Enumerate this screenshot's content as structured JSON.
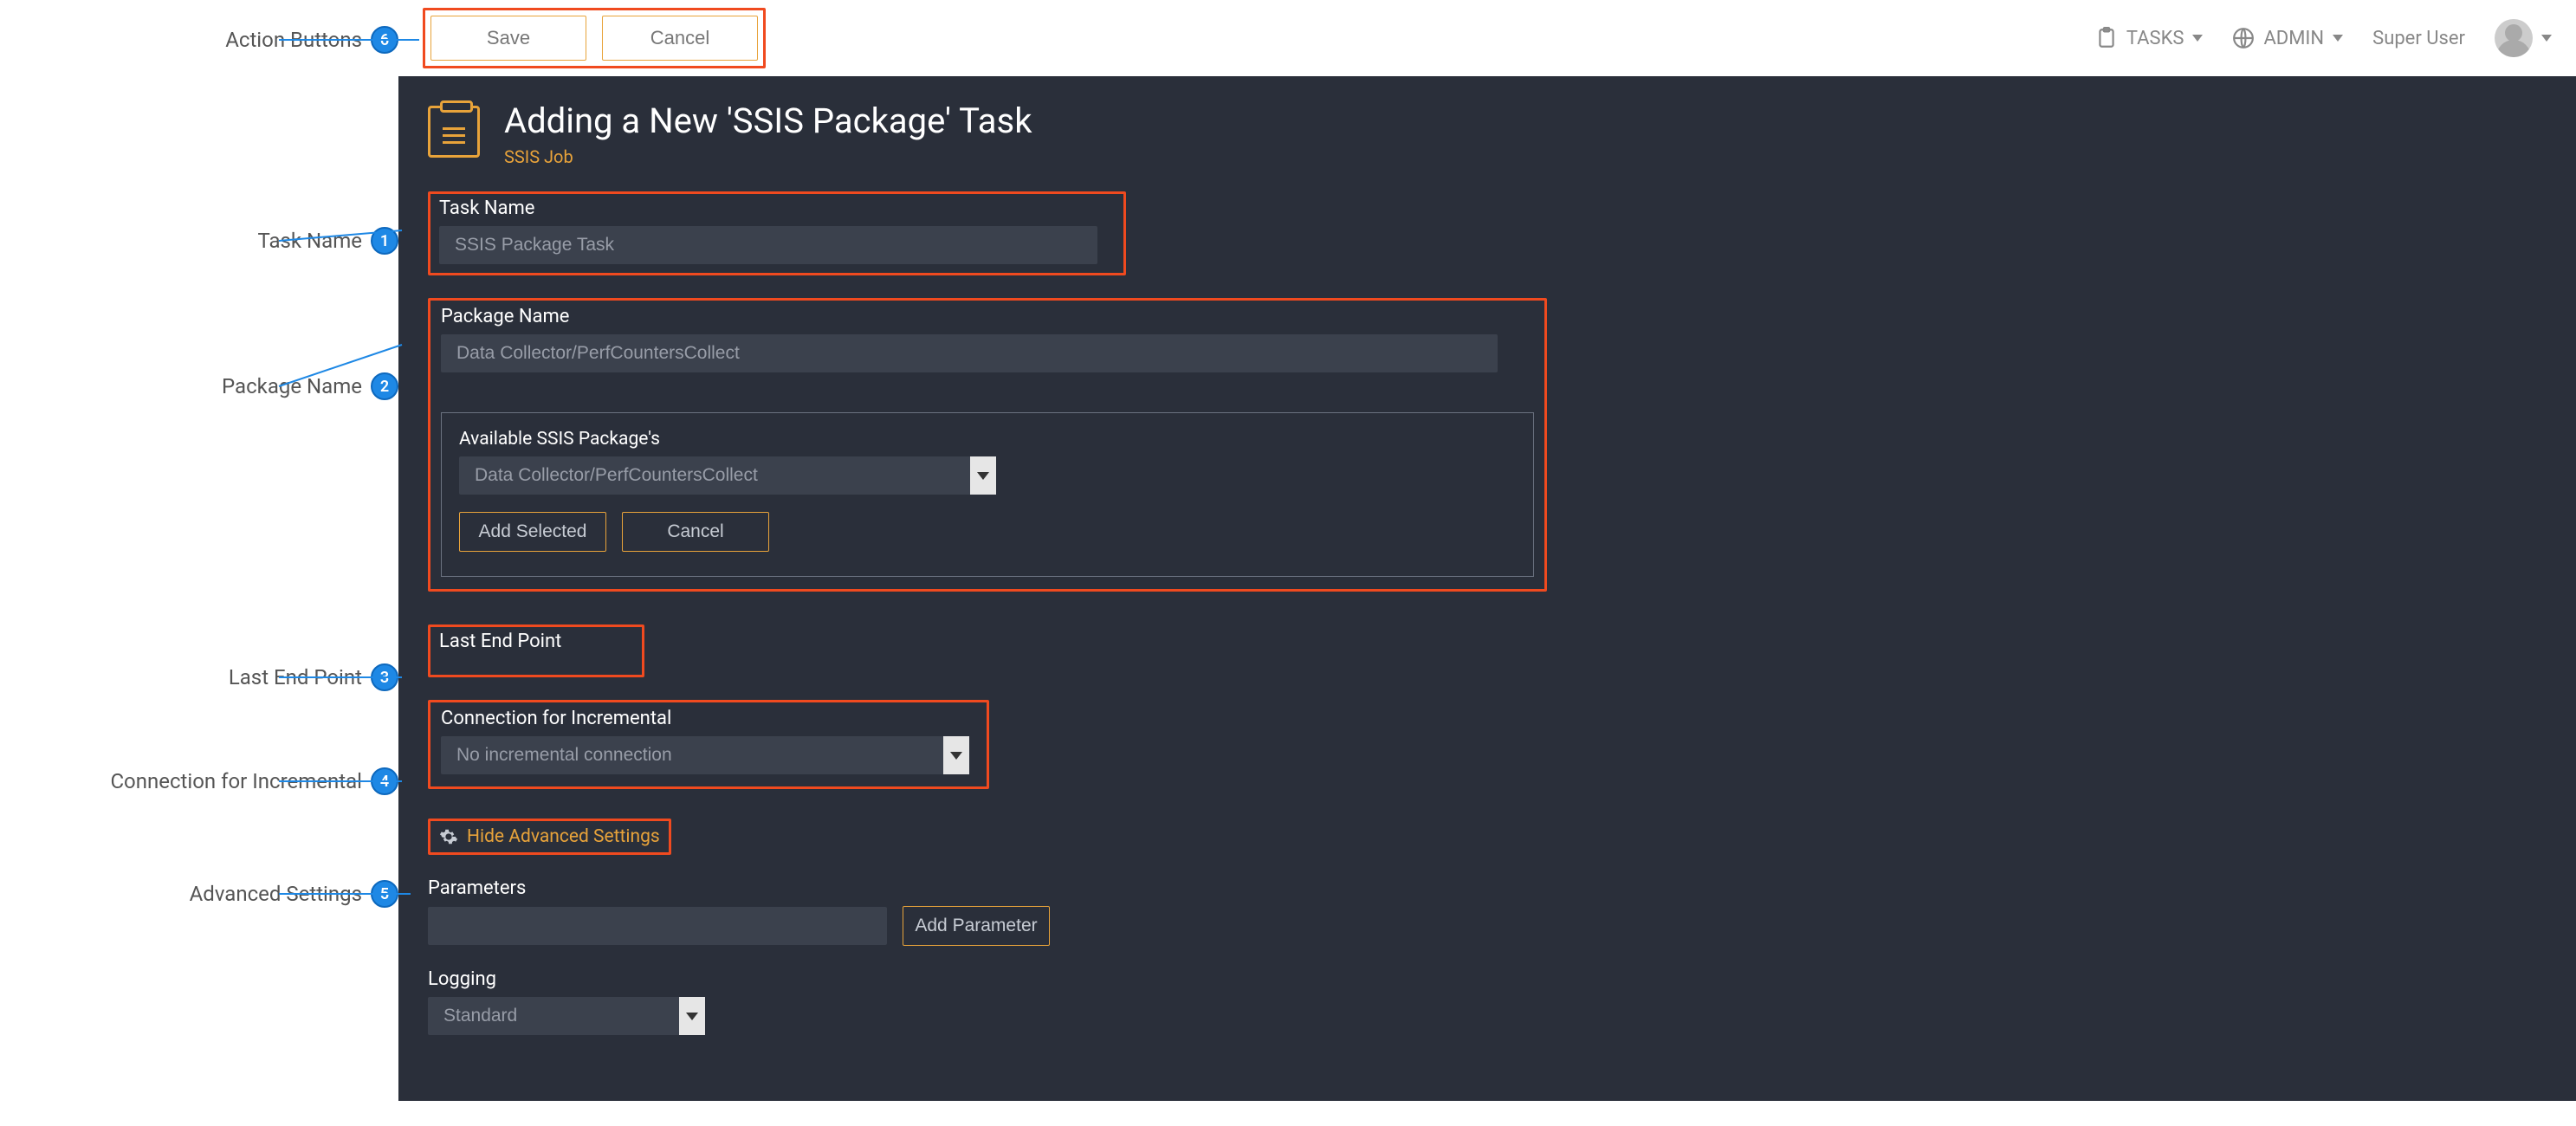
{
  "annotations": [
    {
      "n": 6,
      "label": "Action Buttons"
    },
    {
      "n": 1,
      "label": "Task Name"
    },
    {
      "n": 2,
      "label": "Package Name"
    },
    {
      "n": 3,
      "label": "Last End Point"
    },
    {
      "n": 4,
      "label": "Connection for Incremental"
    },
    {
      "n": 5,
      "label": "Advanced Settings"
    }
  ],
  "topbar": {
    "save": "Save",
    "cancel": "Cancel",
    "tasks": "TASKS",
    "admin": "ADMIN",
    "user": "Super User"
  },
  "header": {
    "title": "Adding a New 'SSIS Package' Task",
    "subtitle": "SSIS Job"
  },
  "form": {
    "taskname_label": "Task Name",
    "taskname_value": "SSIS Package Task",
    "pkgname_label": "Package Name",
    "pkgname_value": "Data Collector/PerfCountersCollect",
    "avail_label": "Available SSIS Package's",
    "avail_value": "Data Collector/PerfCountersCollect",
    "add_selected": "Add Selected",
    "cancel": "Cancel",
    "lep_label": "Last End Point",
    "conn_label": "Connection for Incremental",
    "conn_value": "No incremental connection",
    "adv_toggle": "Hide Advanced Settings",
    "params_label": "Parameters",
    "add_param": "Add Parameter",
    "logging_label": "Logging",
    "logging_value": "Standard"
  }
}
